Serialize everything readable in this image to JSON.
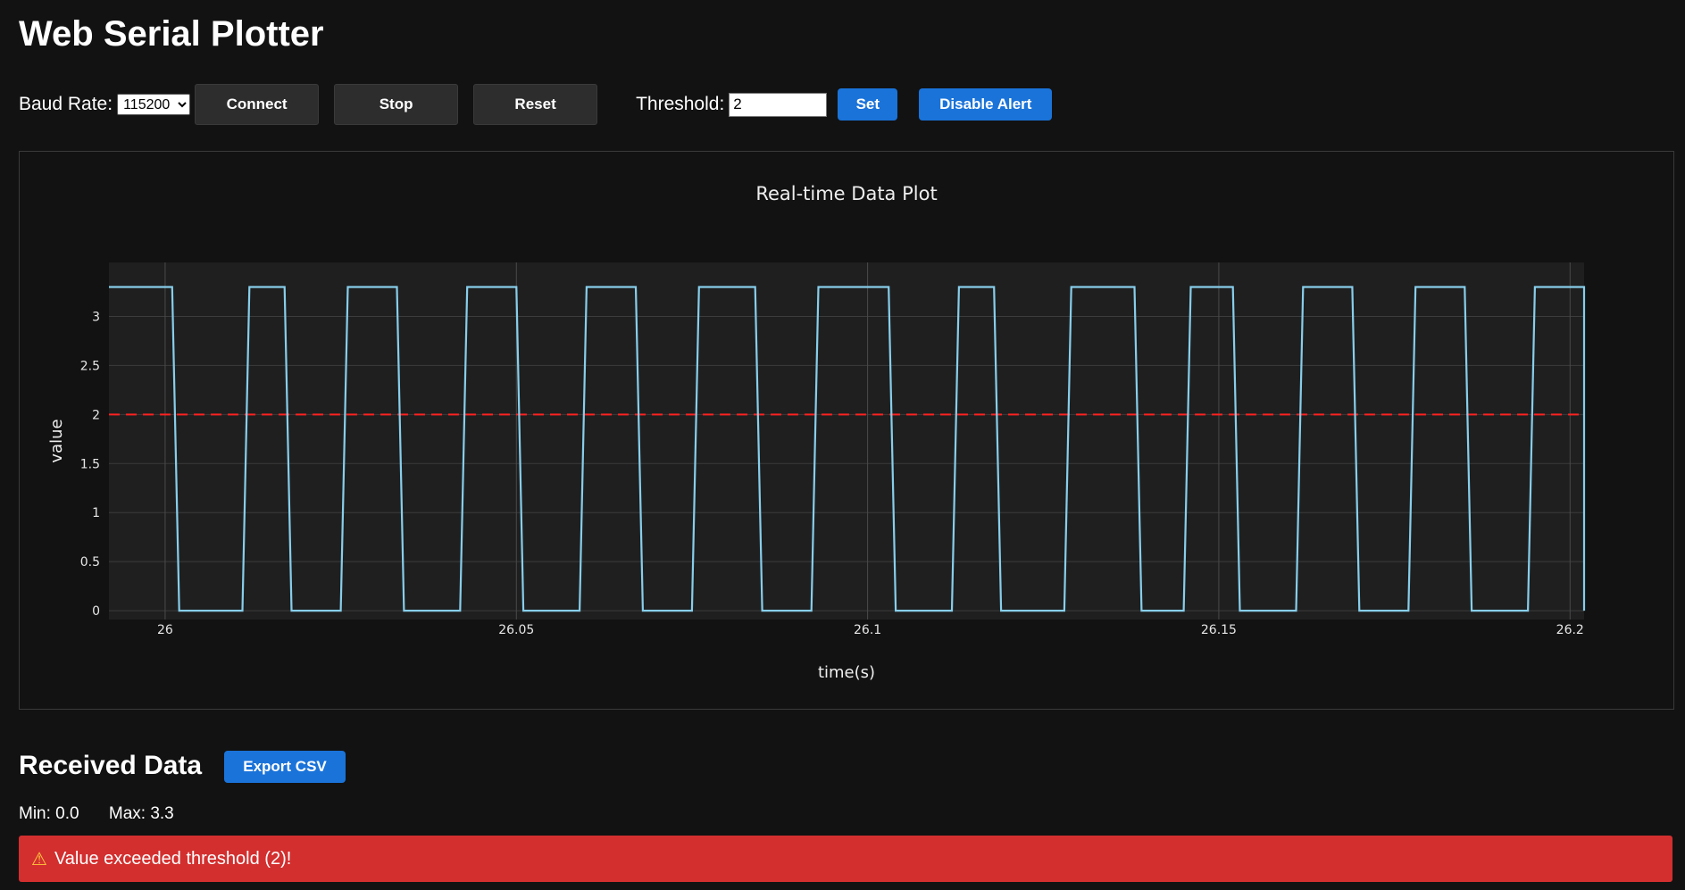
{
  "page_title": "Web Serial Plotter",
  "controls": {
    "baud_label": "Baud Rate:",
    "baud_value": "115200",
    "baud_options": [
      "115200"
    ],
    "connect_label": "Connect",
    "stop_label": "Stop",
    "reset_label": "Reset",
    "threshold_label": "Threshold:",
    "threshold_value": "2",
    "set_label": "Set",
    "disable_alert_label": "Disable Alert"
  },
  "colors": {
    "background": "#121212",
    "plot_bg": "#1f1f1f",
    "signal": "#87ceeb",
    "threshold_line": "#ff2020",
    "accent_blue": "#1a73d9",
    "alert_red": "#d32f2f"
  },
  "chart_data": {
    "type": "line",
    "title": "Real-time Data Plot",
    "xlabel": "time(s)",
    "ylabel": "value",
    "xlim": [
      25.992,
      26.202
    ],
    "ylim": [
      -0.09,
      3.55
    ],
    "x_ticks": [
      26,
      26.05,
      26.1,
      26.15,
      26.2
    ],
    "x_tick_labels": [
      "26",
      "26.05",
      "26.1",
      "26.15",
      "26.2"
    ],
    "y_ticks": [
      0,
      0.5,
      1,
      1.5,
      2,
      2.5,
      3
    ],
    "y_tick_labels": [
      "0",
      "0.5",
      "1",
      "1.5",
      "2",
      "2.5",
      "3"
    ],
    "grid": true,
    "threshold": 2,
    "series": [
      {
        "x": [
          25.992,
          26.001,
          26.002,
          26.011,
          26.012,
          26.017,
          26.018,
          26.025,
          26.026,
          26.033,
          26.034,
          26.042,
          26.043,
          26.05,
          26.051,
          26.059,
          26.06,
          26.067,
          26.068,
          26.075,
          26.076,
          26.084,
          26.085,
          26.092,
          26.093,
          26.103,
          26.104,
          26.112,
          26.113,
          26.118,
          26.119,
          26.128,
          26.129,
          26.138,
          26.139,
          26.145,
          26.146,
          26.152,
          26.153,
          26.161,
          26.162,
          26.169,
          26.17,
          26.177,
          26.178,
          26.185,
          26.186,
          26.194,
          26.195,
          26.202,
          26.202
        ],
        "y": [
          3.3,
          3.3,
          0,
          0,
          3.3,
          3.3,
          0,
          0,
          3.3,
          3.3,
          0,
          0,
          3.3,
          3.3,
          0,
          0,
          3.3,
          3.3,
          0,
          0,
          3.3,
          3.3,
          0,
          0,
          3.3,
          3.3,
          0,
          0,
          3.3,
          3.3,
          0,
          0,
          3.3,
          3.3,
          0,
          0,
          3.3,
          3.3,
          0,
          0,
          3.3,
          3.3,
          0,
          0,
          3.3,
          3.3,
          0,
          0,
          3.3,
          3.3,
          0
        ]
      }
    ]
  },
  "received": {
    "title": "Received Data",
    "export_label": "Export CSV",
    "min_text": "Min: 0.0",
    "max_text": "Max: 3.3"
  },
  "alert": {
    "icon": "warning-icon",
    "text": "Value exceeded threshold (2)!"
  }
}
